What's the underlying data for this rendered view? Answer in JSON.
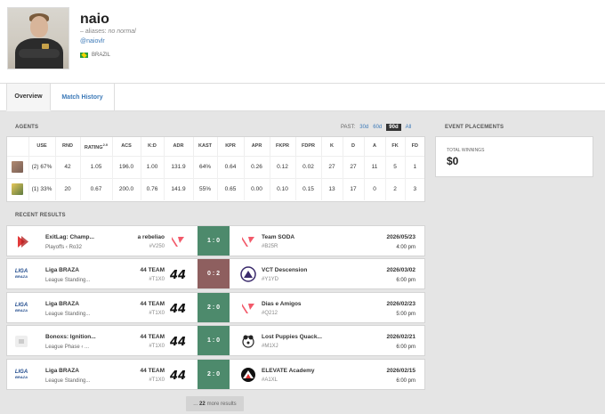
{
  "player": {
    "name": "naio",
    "aliases_label": "– aliases:",
    "aliases_value": "no normal",
    "handle": "@naiovlr",
    "country": "BRAZIL"
  },
  "tabs": [
    "Overview",
    "Match History"
  ],
  "agents_section": {
    "title": "AGENTS",
    "past_label": "PAST:",
    "filters": [
      "30d",
      "60d",
      "90d",
      "All"
    ],
    "selected_filter": "90d",
    "columns": [
      "",
      "USE",
      "RND",
      "RATING",
      "ACS",
      "K:D",
      "ADR",
      "KAST",
      "KPR",
      "APR",
      "FKPR",
      "FDPR",
      "K",
      "D",
      "A",
      "FK",
      "FD"
    ],
    "rating_sup": "2.0",
    "rows": [
      {
        "icon": "agent-1-icon",
        "cells": [
          "(2) 67%",
          "42",
          "1.05",
          "196.0",
          "1.00",
          "131.9",
          "64%",
          "0.64",
          "0.26",
          "0.12",
          "0.02",
          "27",
          "27",
          "11",
          "5",
          "1"
        ]
      },
      {
        "icon": "agent-2-icon",
        "cells": [
          "(1) 33%",
          "20",
          "0.67",
          "200.0",
          "0.76",
          "141.9",
          "55%",
          "0.65",
          "0.00",
          "0.10",
          "0.15",
          "13",
          "17",
          "0",
          "2",
          "3"
        ]
      }
    ]
  },
  "placements": {
    "title": "EVENT PLACEMENTS",
    "total_label": "TOTAL WINNINGS",
    "total_value": "$0"
  },
  "recent": {
    "title": "RECENT RESULTS",
    "matches": [
      {
        "event": "ExitLag: Champ...",
        "stage": "Playoffs ‹ Ro32",
        "team": "a rebeliao",
        "team_tag": "#V250",
        "score": "1 : 0",
        "result": "win",
        "opp": "Team SODA",
        "opp_tag": "#B25R",
        "date": "2026/05/23",
        "time": "4:00 pm",
        "logo": "exitlag-logo-icon"
      },
      {
        "event": "Liga BRAZA",
        "stage": "League Standing...",
        "team": "44 TEAM",
        "team_tag": "#T1X0",
        "score": "0 : 2",
        "result": "loss",
        "opp": "VCT Descension",
        "opp_tag": "#Y1YD",
        "date": "2026/03/02",
        "time": "6:00 pm",
        "logo": "liga-braza-logo-icon"
      },
      {
        "event": "Liga BRAZA",
        "stage": "League Standing...",
        "team": "44 TEAM",
        "team_tag": "#T1X0",
        "score": "2 : 0",
        "result": "win",
        "opp": "Dias e Amigos",
        "opp_tag": "#Q212",
        "date": "2026/02/23",
        "time": "5:00 pm",
        "logo": "liga-braza-logo-icon"
      },
      {
        "event": "Bonoxs: Ignition...",
        "stage": "League Phase ‹ ...",
        "team": "44 TEAM",
        "team_tag": "#T1X0",
        "score": "1 : 0",
        "result": "win",
        "opp": "Lost Puppies Quack...",
        "opp_tag": "#M1XJ",
        "date": "2026/02/21",
        "time": "6:00 pm",
        "logo": "bonoxs-logo-icon"
      },
      {
        "event": "Liga BRAZA",
        "stage": "League Standing...",
        "team": "44 TEAM",
        "team_tag": "#T1X0",
        "score": "2 : 0",
        "result": "win",
        "opp": "ELEVATE Academy",
        "opp_tag": "#A1XL",
        "date": "2026/02/15",
        "time": "6:00 pm",
        "logo": "liga-braza-logo-icon"
      }
    ],
    "more_count": "22",
    "more_label": "more results",
    "more_prefix": "..."
  },
  "liga_logo_text": "LIGA",
  "liga_logo_sub": "BRAZA"
}
